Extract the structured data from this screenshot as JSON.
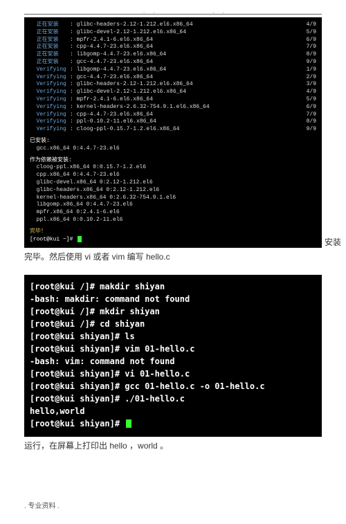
{
  "hr": "",
  "install_lines": [
    {
      "label": "正在安装",
      "pkg": ": glibc-headers-2.12-1.212.el6.x86_64",
      "n": "4/9"
    },
    {
      "label": "正在安装",
      "pkg": ": glibc-devel-2.12-1.212.el6.x86_64",
      "n": "5/9"
    },
    {
      "label": "正在安装",
      "pkg": ": mpfr-2.4.1-6.el6.x86_64",
      "n": "6/9"
    },
    {
      "label": "正在安装",
      "pkg": ": cpp-4.4.7-23.el6.x86_64",
      "n": "7/9"
    },
    {
      "label": "正在安装",
      "pkg": ": libgomp-4.4.7-23.el6.x86_64",
      "n": "8/9"
    },
    {
      "label": "正在安装",
      "pkg": ": gcc-4.4.7-23.el6.x86_64",
      "n": "9/9"
    },
    {
      "label": "Verifying",
      "pkg": ": libgomp-4.4.7-23.el6.x86_64",
      "n": "1/9"
    },
    {
      "label": "Verifying",
      "pkg": ": gcc-4.4.7-23.el6.x86_64",
      "n": "2/9"
    },
    {
      "label": "Verifying",
      "pkg": ": glibc-headers-2.12-1.212.el6.x86_64",
      "n": "3/9"
    },
    {
      "label": "Verifying",
      "pkg": ": glibc-devel-2.12-1.212.el6.x86_64",
      "n": "4/9"
    },
    {
      "label": "Verifying",
      "pkg": ": mpfr-2.4.1-6.el6.x86_64",
      "n": "5/9"
    },
    {
      "label": "Verifying",
      "pkg": ": kernel-headers-2.6.32-754.9.1.el6.x86_64",
      "n": "6/9"
    },
    {
      "label": "Verifying",
      "pkg": ": cpp-4.4.7-23.el6.x86_64",
      "n": "7/9"
    },
    {
      "label": "Verifying",
      "pkg": ": ppl-0.10.2-11.el6.x86_64",
      "n": "8/9"
    },
    {
      "label": "Verifying",
      "pkg": ": cloog-ppl-0.15.7-1.2.el6.x86_64",
      "n": "9/9"
    }
  ],
  "section_installed": "已安装:",
  "installed_pkg": "  gcc.x86_64 0:4.4.7-23.el6",
  "section_deps": "作为依赖被安装:",
  "dep_lines": [
    "  cloog-ppl.x86_64 0:0.15.7-1.2.el6",
    "  cpp.x86_64 0:4.4.7-23.el6",
    "  glibc-devel.x86_64 0:2.12-1.212.el6",
    "  glibc-headers.x86_64 0:2.12-1.212.el6",
    "  kernel-headers.x86_64 0:2.6.32-754.9.1.el6",
    "  libgomp.x86_64 0:4.4.7-23.el6",
    "  mpfr.x86_64 0:2.4.1-6.el6",
    "  ppl.x86_64 0:0.10.2-11.el6"
  ],
  "done": "完毕！",
  "prompt0": "[root@kui ~]# ",
  "after_install": "安装",
  "body1": "完毕。然后使用  vi 或者 vim 编写 hello.c",
  "term2_lines": [
    "[root@kui /]# makdir shiyan",
    "-bash: makdir: command not found",
    "[root@kui /]# mkdir shiyan",
    "[root@kui /]# cd shiyan",
    "[root@kui shiyan]# ls",
    "[root@kui shiyan]# vim 01-hello.c",
    "-bash: vim: command not found",
    "[root@kui shiyan]# vi 01-hello.c",
    "[root@kui shiyan]# gcc 01-hello.c -o 01-hello.c",
    "[root@kui shiyan]# ./01-hello.c",
    "hello,world",
    "[root@kui shiyan]# "
  ],
  "body2": "运行，在屏幕上打印出   hello ，world 。",
  "footer": ". 专业资料 ."
}
